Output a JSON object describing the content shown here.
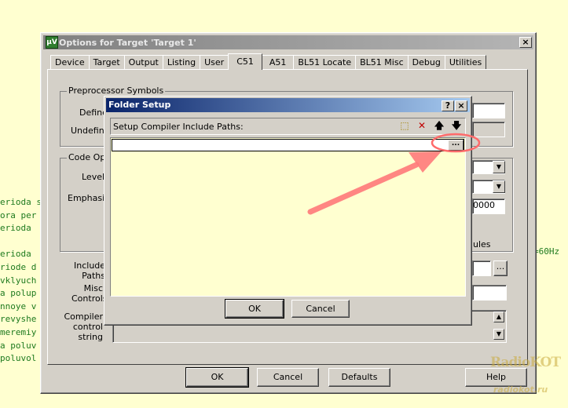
{
  "background": {
    "code_lines": [
      "erioda s",
      "ora per",
      "erioda",
      "",
      "erioda",
      "riode d",
      "vklyuch",
      "a polup",
      "nnoye v",
      "revyshe",
      "meremiy",
      "a poluv",
      "poluvol"
    ],
    "code_right": "=60Hz"
  },
  "options_window": {
    "title": "Options for Target 'Target 1'",
    "app_icon": "µV",
    "close_glyph": "×",
    "tabs": [
      "Device",
      "Target",
      "Output",
      "Listing",
      "User",
      "C51",
      "A51",
      "BL51 Locate",
      "BL51 Misc",
      "Debug",
      "Utilities"
    ],
    "active_tab": "C51",
    "preprocessor": {
      "title": "Preprocessor Symbols",
      "define_label": "Define",
      "undefine_label": "Undefine"
    },
    "code_opt": {
      "title": "Code Opt",
      "level_label": "Level",
      "emphasis_label": "Emphasis",
      "value_text": "0000",
      "rules_text": "ules"
    },
    "include_paths_label": "Include Paths",
    "misc_controls_label": "Misc Controls",
    "compiler_string_label": "Compiler control string",
    "browse_glyph": "...",
    "buttons": {
      "ok": "OK",
      "cancel": "Cancel",
      "defaults": "Defaults",
      "help": "Help"
    }
  },
  "folder_dialog": {
    "title": "Folder Setup",
    "help_glyph": "?",
    "close_glyph": "×",
    "list_label": "Setup Compiler Include Paths:",
    "toolbar_icons": [
      "new-folder-icon",
      "delete-icon",
      "move-up-icon",
      "move-down-icon"
    ],
    "toolbar_glyphs": [
      "⬚",
      "✕",
      "🡅",
      "🡇"
    ],
    "path_value": "",
    "ellipsis_glyph": "...",
    "ok": "OK",
    "cancel": "Cancel"
  },
  "colors": {
    "highlight": "#ff6b6b",
    "dialog_title": "#0a246a"
  },
  "watermark": {
    "logo": "RadioKOT",
    "url": "radiokot.ru"
  }
}
